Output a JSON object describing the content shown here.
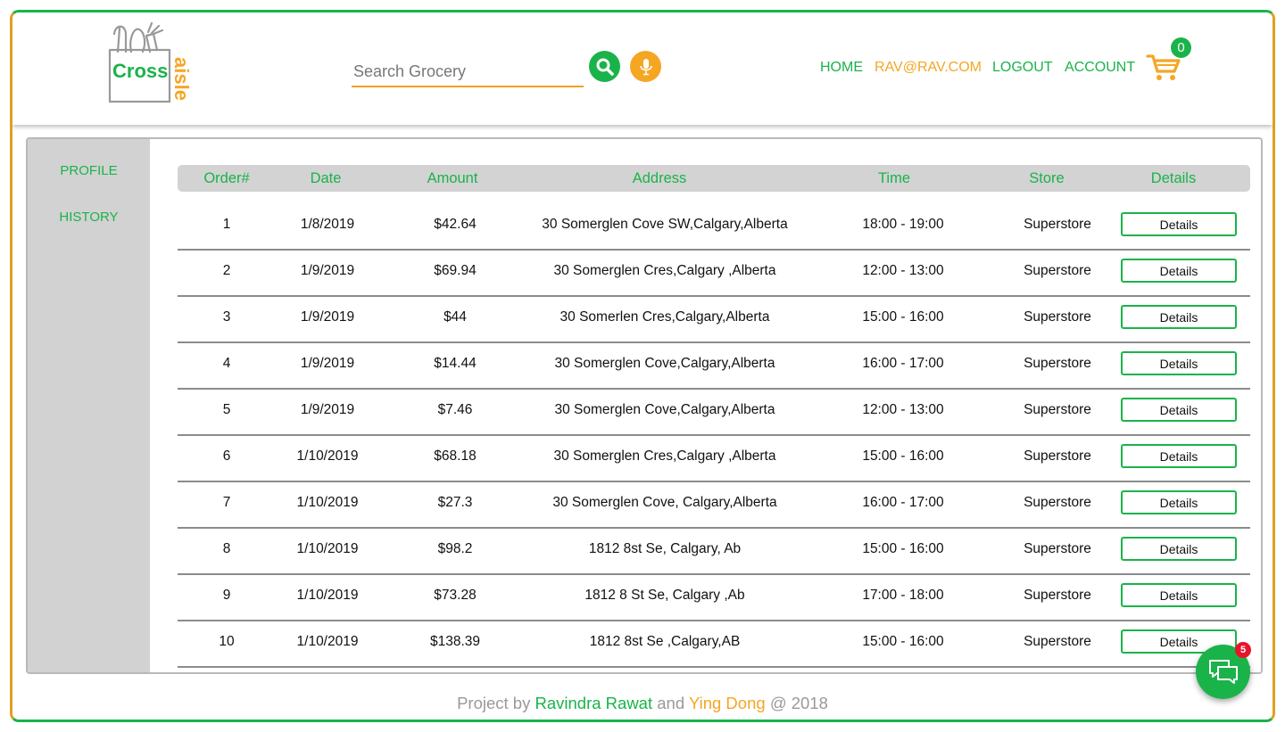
{
  "brand": {
    "logo_word": "Cross",
    "logo_word2": "aisle"
  },
  "search": {
    "placeholder": "Search Grocery"
  },
  "nav": {
    "home": "HOME",
    "user": "RAV@RAV.COM",
    "logout": "LOGOUT",
    "account": "ACCOUNT",
    "cart_count": "0"
  },
  "sidebar": {
    "profile": "PROFILE",
    "history": "HISTORY"
  },
  "table": {
    "headers": {
      "order": "Order#",
      "date": "Date",
      "amount": "Amount",
      "address": "Address",
      "time": "Time",
      "store": "Store",
      "details": "Details"
    },
    "rows": [
      {
        "order": "1",
        "date": "1/8/2019",
        "amount": "$42.64",
        "address": "30 Somerglen Cove SW,Calgary,Alberta",
        "time": "18:00 - 19:00",
        "store": "Superstore",
        "details": "Details"
      },
      {
        "order": "2",
        "date": "1/9/2019",
        "amount": "$69.94",
        "address": "30 Somerglen Cres,Calgary ,Alberta",
        "time": "12:00 - 13:00",
        "store": "Superstore",
        "details": "Details"
      },
      {
        "order": "3",
        "date": "1/9/2019",
        "amount": "$44",
        "address": "30 Somerlen Cres,Calgary,Alberta",
        "time": "15:00 - 16:00",
        "store": "Superstore",
        "details": "Details"
      },
      {
        "order": "4",
        "date": "1/9/2019",
        "amount": "$14.44",
        "address": "30 Somerglen Cove,Calgary,Alberta",
        "time": "16:00 - 17:00",
        "store": "Superstore",
        "details": "Details"
      },
      {
        "order": "5",
        "date": "1/9/2019",
        "amount": "$7.46",
        "address": "30 Somerglen Cove,Calgary,Alberta",
        "time": "12:00 - 13:00",
        "store": "Superstore",
        "details": "Details"
      },
      {
        "order": "6",
        "date": "1/10/2019",
        "amount": "$68.18",
        "address": "30 Somerglen Cres,Calgary ,Alberta",
        "time": "15:00 - 16:00",
        "store": "Superstore",
        "details": "Details"
      },
      {
        "order": "7",
        "date": "1/10/2019",
        "amount": "$27.3",
        "address": "30 Somerglen Cove, Calgary,Alberta",
        "time": "16:00 - 17:00",
        "store": "Superstore",
        "details": "Details"
      },
      {
        "order": "8",
        "date": "1/10/2019",
        "amount": "$98.2",
        "address": "1812 8st Se, Calgary, Ab",
        "time": "15:00 - 16:00",
        "store": "Superstore",
        "details": "Details"
      },
      {
        "order": "9",
        "date": "1/10/2019",
        "amount": "$73.28",
        "address": "1812 8 St Se, Calgary ,Ab",
        "time": "17:00 - 18:00",
        "store": "Superstore",
        "details": "Details"
      },
      {
        "order": "10",
        "date": "1/10/2019",
        "amount": "$138.39",
        "address": "1812 8st Se ,Calgary,AB",
        "time": "15:00 - 16:00",
        "store": "Superstore",
        "details": "Details"
      }
    ]
  },
  "footer": {
    "prefix": "Project by",
    "author1": "Ravindra Rawat",
    "and": "and",
    "author2": "Ying Dong",
    "suffix": "@ 2018"
  },
  "chat": {
    "badge": "5",
    "icon": "chat-icon"
  },
  "colors": {
    "primary": "#1ab34a",
    "accent": "#f5a623",
    "sidebar": "#d2d2d2",
    "header_row": "#d3d3d3"
  }
}
